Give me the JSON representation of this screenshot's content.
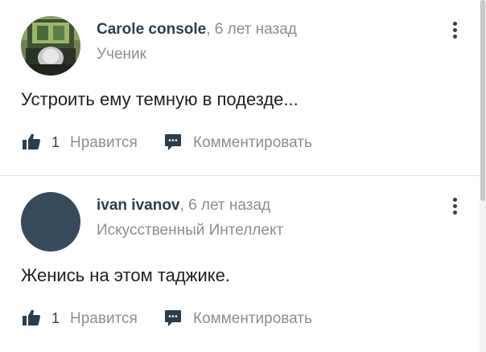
{
  "comments": [
    {
      "author": "Carole console",
      "separator": ",",
      "time_ago": "6 лет назад",
      "rank": "Ученик",
      "avatar": "photo",
      "text": "Устроить ему темную в подезде...",
      "likes": "1",
      "like_label": "Нравится",
      "comment_label": "Комментировать"
    },
    {
      "author": "ivan ivanov",
      "separator": ",",
      "time_ago": "6 лет назад",
      "rank": "Искусственный Интеллект",
      "avatar": "default",
      "text": "Женись на этом таджике.",
      "likes": "1",
      "like_label": "Нравится",
      "comment_label": "Комментировать"
    }
  ],
  "icons": {
    "like": "thumbs-up-icon",
    "comment": "speech-bubble-icon",
    "menu": "more-vertical-icon"
  },
  "colors": {
    "author": "#2f3e4e",
    "muted": "#8a8f96",
    "avatar_default": "#374a5c",
    "icon": "#2d3d4c"
  }
}
